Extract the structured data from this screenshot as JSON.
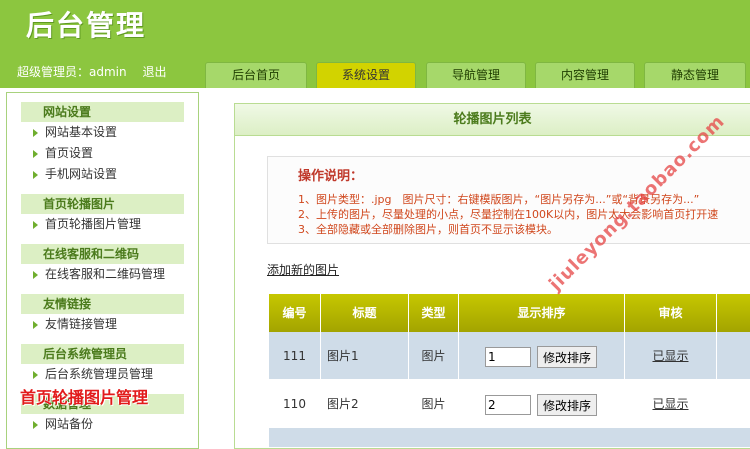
{
  "header": {
    "logo": "后台管理",
    "user_label": "超级管理员：admin",
    "logout": "退出"
  },
  "tabs": [
    {
      "label": "后台首页"
    },
    {
      "label": "系统设置"
    },
    {
      "label": "导航管理"
    },
    {
      "label": "内容管理"
    },
    {
      "label": "静态管理"
    }
  ],
  "sidebar": {
    "groups": [
      {
        "title": "网站设置",
        "items": [
          "网站基本设置",
          "首页设置",
          "手机网站设置"
        ]
      },
      {
        "title": "首页轮播图片",
        "items": [
          "首页轮播图片管理"
        ]
      },
      {
        "title": "在线客服和二维码",
        "items": [
          "在线客服和二维码管理"
        ]
      },
      {
        "title": "友情链接",
        "items": [
          "友情链接管理"
        ]
      },
      {
        "title": "后台系统管理员",
        "items": [
          "后台系统管理员管理"
        ]
      },
      {
        "title": "数据管理",
        "items": [
          "网站备份"
        ]
      }
    ]
  },
  "overlay_title": "首页轮播图片管理",
  "main": {
    "title": "轮播图片列表",
    "notes_title": "操作说明：",
    "notes": [
      "1、图片类型：.jpg　图片尺寸：右键模版图片，“图片另存为...”或“背景另存为...”",
      "2、上传的图片，尽量处理的小点，尽量控制在100K以内，图片太大会影响首页打开速",
      "3、全部隐藏或全部删除图片，则首页不显示该模块。"
    ],
    "add_link": "添加新的图片",
    "table": {
      "headers": [
        "编号",
        "标题",
        "类型",
        "显示排序",
        "审核"
      ],
      "rows": [
        {
          "id": "111",
          "title": "图片1",
          "type": "图片",
          "sort": "1",
          "button": "修改排序",
          "audit": "已显示"
        },
        {
          "id": "110",
          "title": "图片2",
          "type": "图片",
          "sort": "2",
          "button": "修改排序",
          "audit": "已显示"
        }
      ]
    }
  },
  "watermark": "jiuleyong.taobao.com",
  "colors": {
    "header_green": "#8cc63f",
    "tab_active": "#d2d300",
    "table_header": "#b5b600",
    "row_alt": "#cfdce8",
    "overlay_red": "#e21b1b"
  }
}
